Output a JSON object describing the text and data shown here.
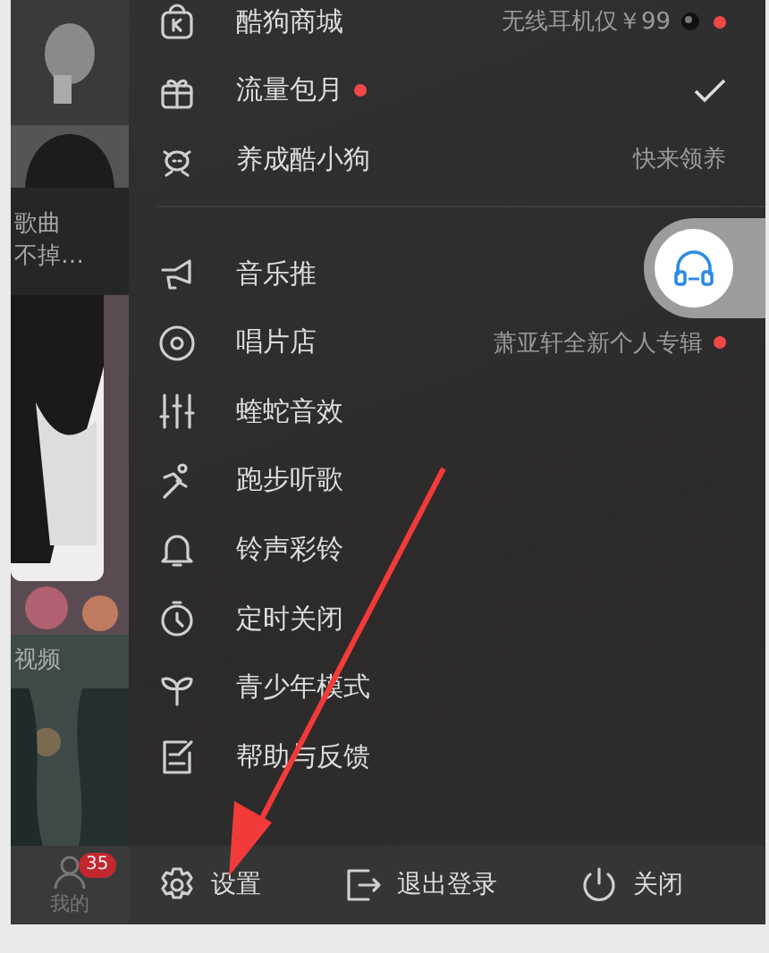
{
  "side_panel": {
    "captions": [
      "歌曲",
      "不掉…",
      "视频"
    ],
    "tab": {
      "label": "我的",
      "badge": "35"
    }
  },
  "menu": {
    "groups": [
      [
        {
          "kind": "link",
          "label": "酷狗商城",
          "subtitle": "无线耳机仅￥99",
          "dot": true
        },
        {
          "kind": "check",
          "label": "流量包月",
          "dot": true
        },
        {
          "kind": "link",
          "label": "养成酷小狗",
          "subtitle": "快来领养",
          "dot": false
        }
      ],
      [
        {
          "kind": "link",
          "label": "音乐推",
          "dot": false
        },
        {
          "kind": "link",
          "label": "唱片店",
          "subtitle": "萧亚轩全新个人专辑",
          "dot": true
        },
        {
          "kind": "link",
          "label": "蝰蛇音效",
          "dot": false
        },
        {
          "kind": "link",
          "label": "跑步听歌",
          "dot": false
        },
        {
          "kind": "link",
          "label": "铃声彩铃",
          "dot": false
        },
        {
          "kind": "link",
          "label": "定时关闭",
          "dot": false
        },
        {
          "kind": "link",
          "label": "青少年模式",
          "dot": false
        },
        {
          "kind": "link",
          "label": "帮助与反馈",
          "dot": false
        }
      ]
    ]
  },
  "footer": {
    "buttons": [
      "设置",
      "退出登录",
      "关闭"
    ]
  }
}
